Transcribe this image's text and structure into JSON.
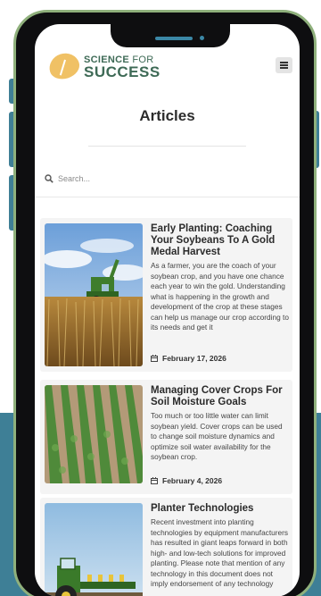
{
  "brand": {
    "line1_a": "SCIENCE",
    "line1_b": "FOR",
    "line2": "SUCCESS"
  },
  "page": {
    "title": "Articles"
  },
  "search": {
    "placeholder": "Search..."
  },
  "articles": [
    {
      "title": "Early Planting: Coaching Your Soybeans To A Gold Medal Harvest",
      "excerpt": "As a farmer, you are the coach of your soybean crop, and you have one chance each year to win the gold. Understanding what is happening in the growth and development of the crop at these stages can help us manage our crop according to its needs and get it",
      "date": "February 17, 2026",
      "image_icon": "combine-harvester-wheat-field-photo"
    },
    {
      "title": "Managing Cover Crops For Soil Moisture Goals",
      "excerpt": "Too much or too little water can limit soybean yield. Cover crops can be used to change soil moisture dynamics and optimize soil water availability for the soybean crop.",
      "date": "February 4, 2026",
      "image_icon": "crop-rows-field-photo"
    },
    {
      "title": "Planter Technologies",
      "excerpt": "Recent investment into planting technologies by equipment manufacturers has resulted in giant leaps forward in both high- and low-tech solutions for improved planting. Please note that mention of any technology in this document does not imply endorsement of any technology",
      "date": "",
      "image_icon": "tractor-planter-photo"
    }
  ],
  "colors": {
    "brand_green": "#3e6a56",
    "logo_gold": "#f0c165",
    "background_teal": "#3e7f96",
    "phone_frame": "#8fb07c"
  }
}
